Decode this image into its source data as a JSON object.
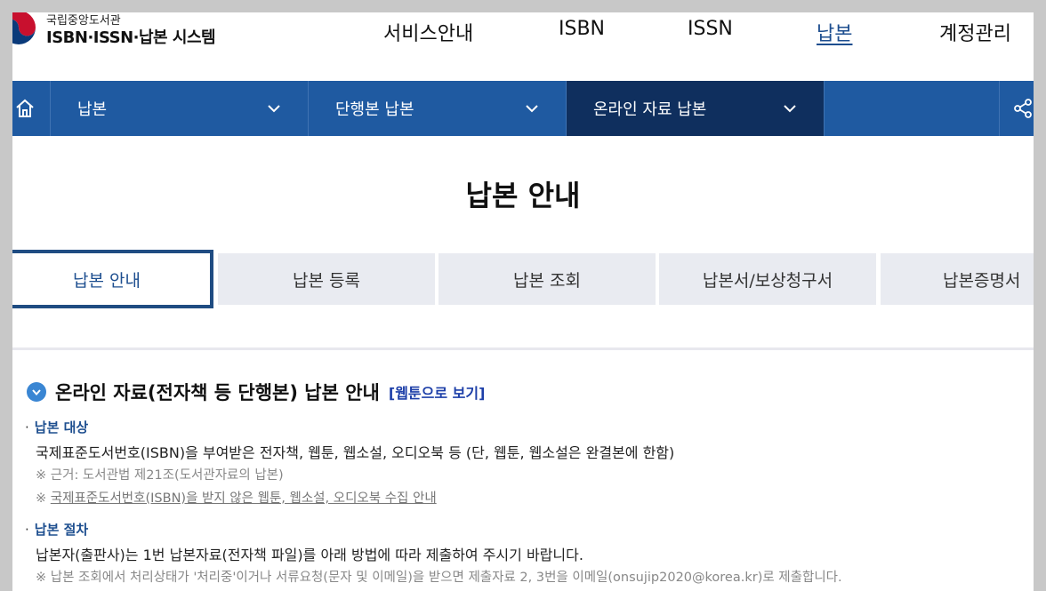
{
  "logo": {
    "small": "국립중앙도서관",
    "big": "ISBN·ISSN·납본 시스템"
  },
  "gnb": [
    {
      "label": "서비스안내",
      "active": false
    },
    {
      "label": "ISBN",
      "active": false
    },
    {
      "label": "ISSN",
      "active": false
    },
    {
      "label": "납본",
      "active": true
    },
    {
      "label": "계정관리",
      "active": false
    }
  ],
  "subnav": {
    "home_icon": "home-icon",
    "items": [
      "납본",
      "단행본 납본",
      "온라인 자료 납본"
    ],
    "share_icon": "share-icon"
  },
  "page_title": "납본 안내",
  "tabs": [
    "납본 안내",
    "납본 등록",
    "납본 조회",
    "납본서/보상청구서",
    "납본증명서"
  ],
  "section": {
    "title": "온라인 자료(전자책 등 단행본) 납본 안내",
    "link": "[웹툰으로 보기]",
    "target": {
      "label": "납본 대상",
      "text": "국제표준도서번호(ISBN)을 부여받은 전자책, 웹툰, 웹소설, 오디오북 등 (단, 웹툰, 웹소설은 완결본에 한함)",
      "note1": "※ 근거: 도서관법 제21조(도서관자료의 납본)",
      "note2_prefix": "※ ",
      "note2_link": "국제표준도서번호(ISBN)을 받지 않은 웹툰, 웹소설, 오디오북 수집 안내"
    },
    "procedure": {
      "label": "납본 절차",
      "text": "납본자(출판사)는 1번 납본자료(전자책 파일)를 아래 방법에 따라 제출하여 주시기 바랍니다.",
      "note": "※ 납본 조회에서 처리상태가 '처리중'이거나 서류요청(문자 및 이메일)을 받으면 제출자료 2, 3번을 이메일(onsujip2020@korea.kr)로 제출합니다."
    }
  },
  "colors": {
    "primary": "#1f5aa1",
    "dark": "#0f2f5e",
    "accent": "#1d4e8f",
    "bullet": "#3a86d3"
  }
}
